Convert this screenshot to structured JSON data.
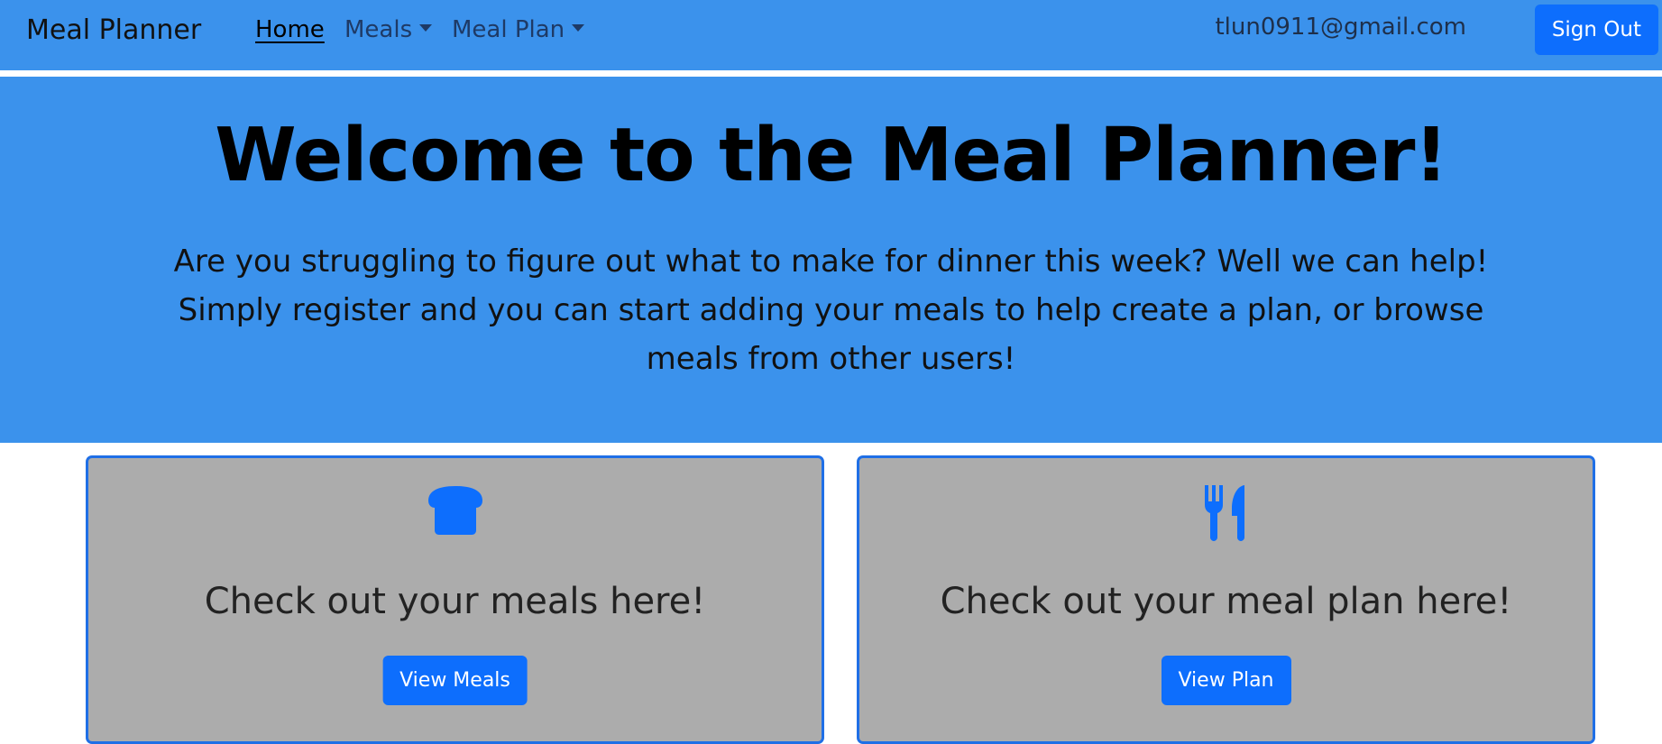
{
  "navbar": {
    "brand": "Meal Planner",
    "links": [
      {
        "label": "Home",
        "active": true
      },
      {
        "label": "Meals",
        "dropdown": true
      },
      {
        "label": "Meal Plan",
        "dropdown": true
      }
    ],
    "user_email": "tlun0911@gmail.com",
    "sign_out_label": "Sign Out"
  },
  "hero": {
    "title": "Welcome to the Meal Planner!",
    "description": "Are you struggling to figure out what to make for dinner this week? Well we can help! Simply register and you can start adding your meals to help create a plan, or browse meals from other users!"
  },
  "cards": [
    {
      "icon": "bread-icon",
      "heading": "Check out your meals here!",
      "button_label": "View Meals"
    },
    {
      "icon": "utensils-icon",
      "heading": "Check out your meal plan here!",
      "button_label": "View Plan"
    }
  ],
  "colors": {
    "navbar_bg": "#3b92ec",
    "hero_bg": "#3b92ec",
    "primary_button": "#0d6efd",
    "card_bg": "#acacac",
    "card_border": "#1f6fe6"
  }
}
